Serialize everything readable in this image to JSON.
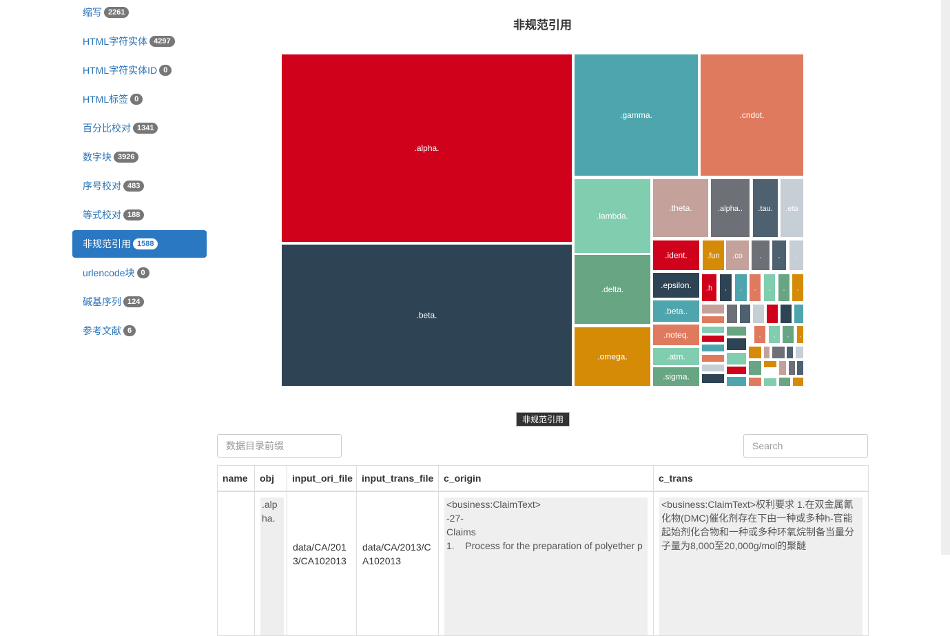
{
  "sidebar": {
    "items": [
      {
        "label": "缩写",
        "count": "2261",
        "active": false
      },
      {
        "label": "HTML字符实体",
        "count": "4297",
        "active": false
      },
      {
        "label": "HTML字符实体ID",
        "count": "0",
        "active": false
      },
      {
        "label": "HTML标签",
        "count": "0",
        "active": false
      },
      {
        "label": "百分比校对",
        "count": "1341",
        "active": false
      },
      {
        "label": "数字块",
        "count": "3926",
        "active": false
      },
      {
        "label": "序号校对",
        "count": "483",
        "active": false
      },
      {
        "label": "等式校对",
        "count": "188",
        "active": false
      },
      {
        "label": "非规范引用",
        "count": "1588",
        "active": true
      },
      {
        "label": "urlencode块",
        "count": "0",
        "active": false
      },
      {
        "label": "碱基序列",
        "count": "124",
        "active": false
      },
      {
        "label": "参考文献",
        "count": "6",
        "active": false
      }
    ]
  },
  "chart": {
    "title": "非规范引用",
    "legend": "非规范引用",
    "tiles": [
      {
        "label": ".alpha.",
        "color": "#d0021b"
      },
      {
        "label": ".beta.",
        "color": "#2e4354"
      },
      {
        "label": ".gamma.",
        "color": "#4fa5ad"
      },
      {
        "label": ".cndot.",
        "color": "#e07a5f"
      },
      {
        "label": ".lambda.",
        "color": "#81cdb0"
      },
      {
        "label": ".delta.",
        "color": "#67a583"
      },
      {
        "label": ".omega.",
        "color": "#d68b07"
      },
      {
        "label": ".theta.",
        "color": "#c4a19b"
      },
      {
        "label": ".alpha..",
        "color": "#6d7076"
      },
      {
        "label": ".tau.",
        "color": "#4d6170"
      },
      {
        "label": ".eta",
        "color": "#c6ced6"
      },
      {
        "label": ".ident.",
        "color": "#d0021b"
      },
      {
        "label": ".epsilon.",
        "color": "#2e4354"
      },
      {
        "label": ".beta..",
        "color": "#4fa5ad"
      },
      {
        "label": ".noteq.",
        "color": "#e07a5f"
      },
      {
        "label": ".atm.",
        "color": "#81cdb0"
      },
      {
        "label": ".sigma.",
        "color": "#67a583"
      },
      {
        "label": ".fun",
        "color": "#d68b07"
      },
      {
        "label": ".co",
        "color": "#c4a19b"
      },
      {
        "label": ".",
        "color": "#6d7076"
      },
      {
        "label": ".",
        "color": "#4d6170"
      },
      {
        "label": ".",
        "color": "#c6ced6"
      },
      {
        "label": ".h",
        "color": "#d0021b"
      },
      {
        "label": ".",
        "color": "#2e4354"
      },
      {
        "label": ".",
        "color": "#4fa5ad"
      },
      {
        "label": ".",
        "color": "#e07a5f"
      },
      {
        "label": ".",
        "color": "#81cdb0"
      },
      {
        "label": ".",
        "color": "#67a583"
      },
      {
        "label": ".",
        "color": "#d68b07"
      },
      {
        "label": ".",
        "color": "#e07a5f"
      },
      {
        "label": ".",
        "color": "#81cdb0"
      },
      {
        "label": ".",
        "color": "#67a583"
      },
      {
        "label": ".",
        "color": "#d68b07"
      }
    ],
    "mini_palette": [
      "#c4a19b",
      "#6d7076",
      "#4d6170",
      "#c6ced6",
      "#d0021b",
      "#2e4354",
      "#4fa5ad",
      "#e07a5f",
      "#81cdb0",
      "#67a583",
      "#d68b07"
    ]
  },
  "filters": {
    "prefix_placeholder": "数据目录前缀",
    "search_placeholder": "Search"
  },
  "table": {
    "columns": [
      "name",
      "obj",
      "input_ori_file",
      "input_trans_file",
      "c_origin",
      "c_trans"
    ],
    "rows": [
      {
        "name": "",
        "obj": ".alpha.",
        "input_ori_file": "data/CA/2013/CA102013",
        "input_trans_file": "data/CA/2013/CA102013",
        "c_origin": "<business:ClaimText>\n-27-\nClaims\n1.    Process for the preparation of polyether p",
        "c_trans": "<business:ClaimText>权利要求\n1.在双金属氰化物(DMC)催化剂存在下由一种或多种h-官能起始剂化合物和一种或多种环氧烷制备当量分子量为8,000至20,000g/mol的聚醚"
      }
    ]
  }
}
